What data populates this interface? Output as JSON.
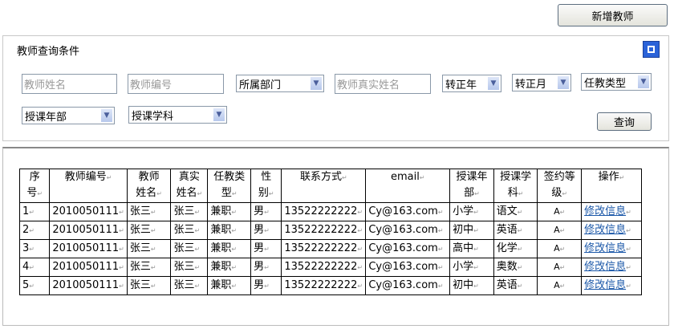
{
  "toolbar": {
    "add_teacher": "新增教师"
  },
  "query": {
    "title": "教师查询条件",
    "teacher_name_placeholder": "教师姓名",
    "teacher_no_placeholder": "教师编号",
    "department": "所属部门",
    "real_name_placeholder": "教师真实姓名",
    "regular_year": "转正年",
    "regular_month": "转正月",
    "teach_type": "任教类型",
    "grade": "授课年部",
    "subject": "授课学科",
    "search": "查询"
  },
  "table": {
    "headers": [
      [
        "序",
        "号"
      ],
      [
        "教师编号",
        ""
      ],
      [
        "教师",
        "姓名"
      ],
      [
        "真实",
        "姓名"
      ],
      [
        "任教类",
        "型"
      ],
      [
        "性",
        "别"
      ],
      [
        "联系方式",
        ""
      ],
      [
        "email",
        ""
      ],
      [
        "授课年",
        "部"
      ],
      [
        "授课学",
        "科"
      ],
      [
        "签约等",
        "级"
      ],
      [
        "操作",
        ""
      ]
    ],
    "rows": [
      [
        "1",
        "2010050111",
        "张三",
        "张三",
        "兼职",
        "男",
        "13522222222",
        "Cy@163.com",
        "小学",
        "语文",
        "A",
        "修改信息"
      ],
      [
        "2",
        "2010050111",
        "张三",
        "张三",
        "兼职",
        "男",
        "13522222222",
        "Cy@163.com",
        "初中",
        "英语",
        "A",
        "修改信息"
      ],
      [
        "3",
        "2010050111",
        "张三",
        "张三",
        "兼职",
        "男",
        "13522222222",
        "Cy@163.com",
        "高中",
        "化学",
        "A",
        "修改信息"
      ],
      [
        "4",
        "2010050111",
        "张三",
        "张三",
        "兼职",
        "男",
        "13522222222",
        "Cy@163.com",
        "小学",
        "奥数",
        "A",
        "修改信息"
      ],
      [
        "5",
        "2010050111",
        "张三",
        "张三",
        "兼职",
        "男",
        "13522222222",
        "Cy@163.com",
        "初中",
        "英语",
        "A",
        "修改信息"
      ]
    ]
  }
}
